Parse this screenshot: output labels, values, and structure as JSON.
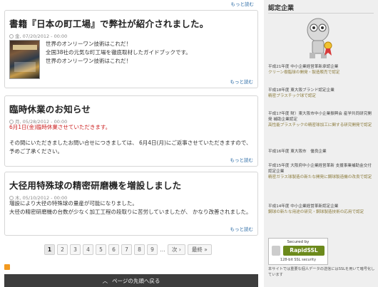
{
  "top_more": "もっと読む",
  "posts": [
    {
      "title": "書籍『日本の町工場』で弊社が紹介されました。",
      "date": "金, 07/20/2012 - 00:00",
      "lines": [
        "世界のオンリーワン技術はこれだ！",
        "全国38社の元気な町工場を徹底取材したガイドブックです。",
        "世界のオンリーワン技術はこれだ！"
      ],
      "more": "もっと読む"
    },
    {
      "title": "臨時休業のお知らせ",
      "date": "月, 05/28/2012 - 00:00",
      "alert": "6月1日(金)臨時休業させていただきます。",
      "lines": [
        "その間にいただきましたお問い合せにつきましては、 6月4日(月)にご返事させていただきますので、 予めご了承ください。"
      ],
      "more": "もっと読む"
    },
    {
      "title": "大径用特殊球の精密研磨機を増設しました",
      "date": "木, 05/10/2012 - 00:00",
      "lines": [
        "増設により大径の特殊球の量産が可能になりました。",
        "大径の精密研磨機の台数が少なく加工工程の段取りに苦労していましたが、 かなり改善されました。"
      ],
      "more": "もっと読む"
    }
  ],
  "pager": {
    "pages": [
      "1",
      "2",
      "3",
      "4",
      "5",
      "6",
      "7",
      "8",
      "9"
    ],
    "current": "1",
    "ellipsis": "…",
    "next": "次 ›",
    "last": "最終 »"
  },
  "totop": {
    "arrow": "︿",
    "label": "ページの先頭へ戻る"
  },
  "sidebar": {
    "title": "認定企業",
    "awards": [
      {
        "title": "平成21年度 中小企業経営革新承認企業",
        "desc": "クリーン樹脂球の開発・製造販売で認定"
      },
      {
        "title": "平成18年度 東大阪ブランド認定企業",
        "desc": "精密プラスチック球で認定"
      },
      {
        "title": "平成17年度 財）東大阪市中小企業振興会 産学共同研究開発 補助企業認定",
        "desc": "高性能プラスチックの精密球加工に関する研究開発で認定"
      },
      {
        "title": "平成16年度 東大阪市　優良企業",
        "desc": ""
      },
      {
        "title": "平成15年度 大阪府中小企業経営革新 支援事業補助金交付認定企業",
        "desc": "精密ガラス球製造の新たな開発に鋼球製造機の改良で認定"
      },
      {
        "title": "平成14年度 中小企業経営革新認定企業",
        "desc": "鋼球の新たな用途の研究・鋼球製造技術の応用で認定"
      }
    ],
    "ssl": {
      "secured": "Secured by",
      "name": "RapidSSL",
      "bits": "128-bit SSL security"
    },
    "ssl_note": "本サイトでは重要な個人データの送信にはSSLを用いて暗号化しています"
  }
}
